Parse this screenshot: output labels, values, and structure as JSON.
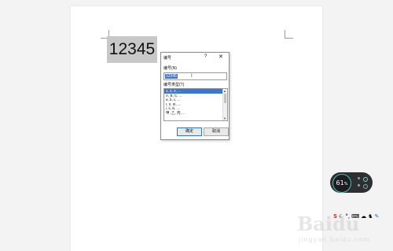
{
  "document": {
    "selected_text": "12345"
  },
  "dialog": {
    "title": "编号",
    "help_glyph": "?",
    "close_glyph": "✕",
    "number_label": "编号(N)",
    "number_value": "12345",
    "type_label": "编号类型(T)",
    "types": [
      "1, 2, 3, ...",
      "A, B, C, ...",
      "a, b, c, ...",
      "I, II, III, ...",
      "i, ii, iii, ...",
      "甲, 乙, 丙, ..."
    ],
    "selected_type_index": 0,
    "ok_label": "确定",
    "cancel_label": "取消"
  },
  "widget": {
    "percent": "61",
    "percent_suffix": "%"
  },
  "tray": {
    "icons": [
      "ime-icon",
      "moon-icon",
      "punctuation-icon",
      "keyboard-icon",
      "cloud-icon",
      "shirt-icon",
      "pencil-icon"
    ],
    "ime_glyph": "S",
    "moon_glyph": "☾",
    "punct_glyph": "°,",
    "keyboard_glyph": "⌨",
    "cloud_glyph": "☁",
    "shirt_glyph": "♞",
    "pencil_glyph": "✎"
  },
  "watermark": {
    "logo": "Baidu",
    "text": "jingyan.baidu.com"
  }
}
